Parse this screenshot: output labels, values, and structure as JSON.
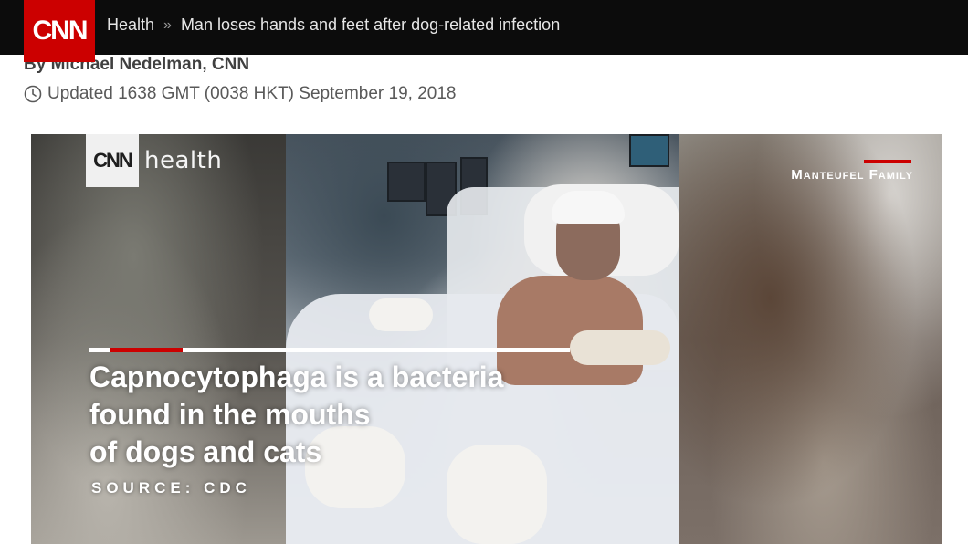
{
  "header": {
    "logo_text": "CNN",
    "breadcrumb": {
      "section": "Health",
      "separator": "»",
      "title": "Man loses hands and feet after dog-related infection"
    }
  },
  "article": {
    "byline": "By Michael Nedelman, CNN",
    "updated": "Updated 1638 GMT (0038 HKT) September 19, 2018"
  },
  "video": {
    "brand_box_text": "CNN",
    "brand_word": "health",
    "credit": "Manteufel Family",
    "caption_lines": [
      "Capnocytophaga is a bacteria",
      "found in the mouths",
      "of dogs and cats"
    ],
    "source": "SOURCE: CDC"
  },
  "colors": {
    "brand_red": "#cc0000",
    "topbar": "#0c0c0c"
  },
  "icons": {
    "clock": "clock-icon"
  }
}
